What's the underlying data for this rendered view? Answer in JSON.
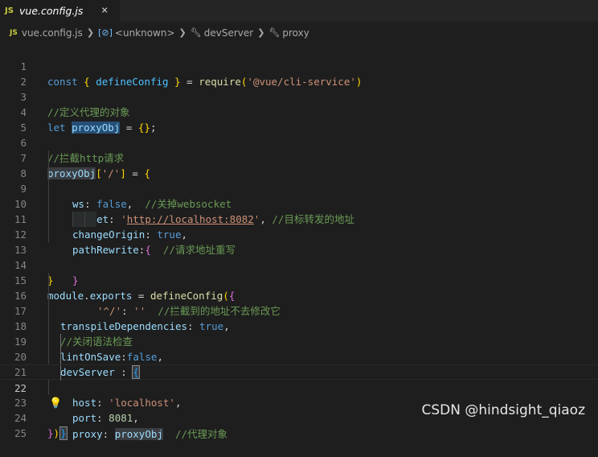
{
  "tab": {
    "icon": "JS",
    "filename": "vue.config.js",
    "close": "×"
  },
  "breadcrumb": {
    "file_icon": "JS",
    "file": "vue.config.js",
    "items": [
      "<unknown>",
      "devServer",
      "proxy"
    ],
    "sym_icon": "[⊘]"
  },
  "code": {
    "l1": {
      "n": "1",
      "a": "const",
      "b": "{",
      "c": "defineConfig",
      "d": "}",
      "e": "=",
      "f": "require",
      "g": "(",
      "h": "'@vue/cli-service'",
      "i": ")"
    },
    "l2": {
      "n": "2"
    },
    "l3": {
      "n": "3",
      "a": "//定义代理的对象"
    },
    "l4": {
      "n": "4",
      "a": "let",
      "b": "proxyObj",
      "c": "=",
      "d": "{}",
      "e": ";"
    },
    "l5": {
      "n": "5"
    },
    "l6": {
      "n": "6",
      "a": "//拦截http请求"
    },
    "l7": {
      "n": "7",
      "a": "proxyObj",
      "b": "[",
      "c": "'/'",
      "d": "]",
      "e": "=",
      "f": "{"
    },
    "l8": {
      "n": "8",
      "a": "ws",
      "b": ":",
      "c": "false",
      "d": ",",
      "e": "//关掉websocket"
    },
    "l9": {
      "n": "9",
      "a": "target",
      "b": ":",
      "c": "'",
      "d": "http://localhost:8082",
      "e": "'",
      "f": ",",
      "g": "//目标转发的地址"
    },
    "l10": {
      "n": "10",
      "a": "changeOrigin",
      "b": ":",
      "c": "true",
      "d": ","
    },
    "l11": {
      "n": "11",
      "a": "pathRewrite",
      "b": ":",
      "c": "{",
      "d": "//请求地址重写"
    },
    "l12": {
      "n": "12",
      "a": "'^/'",
      "b": ":",
      "c": "''",
      "d": "//拦截到的地址不去修改它"
    },
    "l13": {
      "n": "13",
      "a": "}"
    },
    "l14": {
      "n": "14",
      "a": "}"
    },
    "l15": {
      "n": "15",
      "a": "module",
      "b": ".",
      "c": "exports",
      "d": "=",
      "e": "defineConfig",
      "f": "(",
      "g": "{"
    },
    "l16": {
      "n": "16",
      "a": "transpileDependencies",
      "b": ":",
      "c": "true",
      "d": ","
    },
    "l17": {
      "n": "17",
      "a": "//关闭语法检查"
    },
    "l18": {
      "n": "18",
      "a": "lintOnSave",
      "b": ":",
      "c": "false",
      "d": ","
    },
    "l19": {
      "n": "19",
      "a": "devServer",
      "b": ":",
      "c": "{"
    },
    "l20": {
      "n": "20",
      "a": "host",
      "b": ":",
      "c": "'localhost'",
      "d": ","
    },
    "l21": {
      "n": "21",
      "a": "port",
      "b": ":",
      "c": "8081",
      "d": ","
    },
    "l22": {
      "n": "22",
      "a": "proxy",
      "b": ":",
      "c": "proxyObj",
      "d": "//代理对象",
      "bulb": "💡"
    },
    "l23": {
      "n": "23",
      "a": "}"
    },
    "l24": {
      "n": "24",
      "a": "}",
      "b": ")"
    },
    "l25": {
      "n": "25"
    }
  },
  "watermark": "CSDN @hindsight_qiaoz",
  "colors": {
    "background": "#1e1e1e",
    "keyword": "#569cd6",
    "variable": "#9cdcfe",
    "function": "#dcdcaa",
    "string": "#ce9178",
    "comment": "#6a9955"
  }
}
